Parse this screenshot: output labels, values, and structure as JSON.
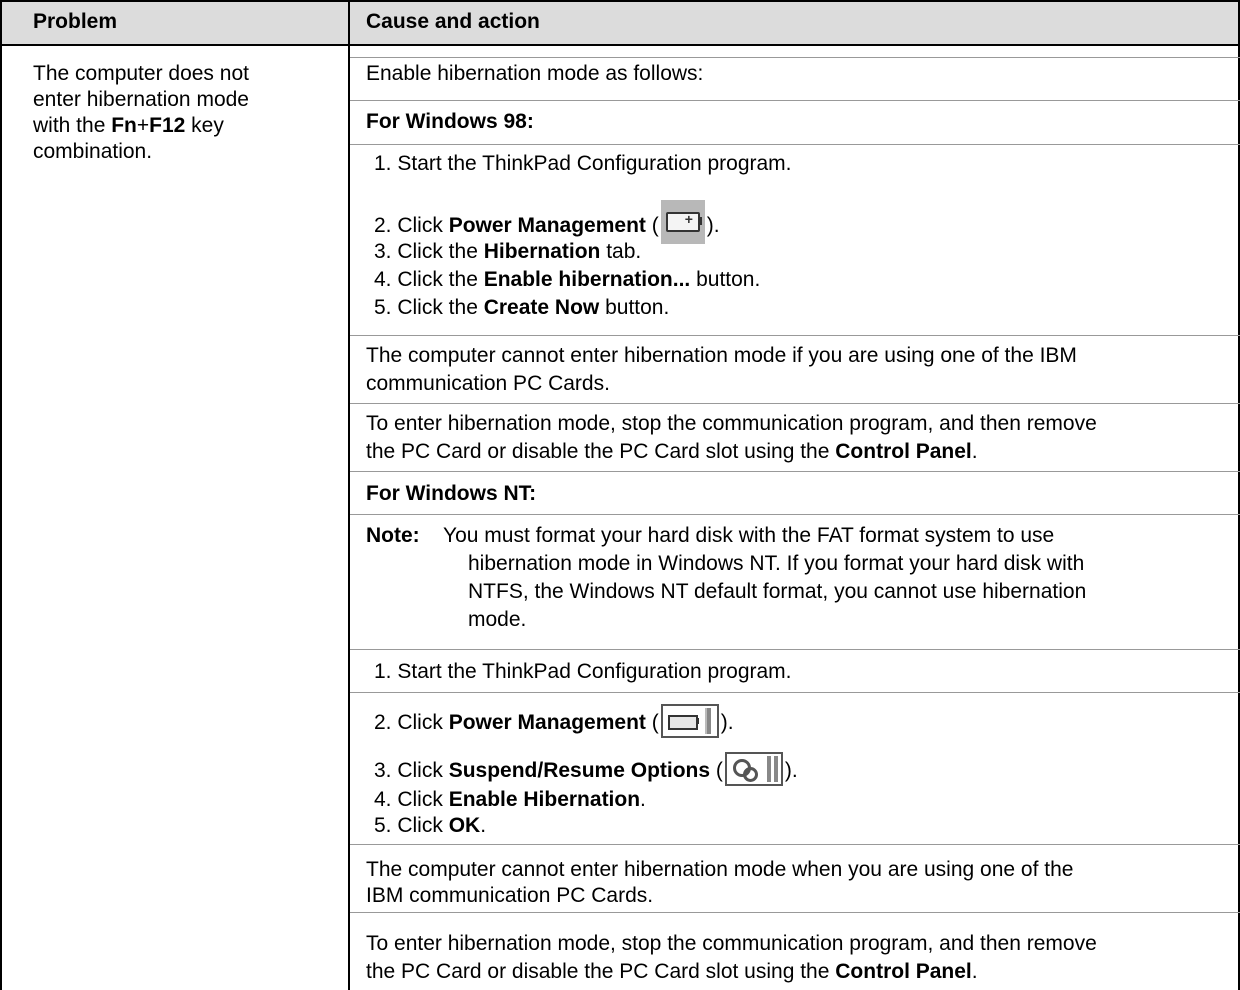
{
  "header": {
    "problem_col": "Problem",
    "cause_col": "Cause and action"
  },
  "problem": {
    "line1": "The computer does not",
    "line2": "enter hibernation mode",
    "line3_pre": "with the ",
    "line3_fn": "Fn",
    "line3_plus": "+",
    "line3_f12": "F12",
    "line3_post": " key",
    "line4": "combination."
  },
  "cause": {
    "intro": "Enable hibernation mode as follows:",
    "win98_heading": "For Windows 98:",
    "w98_s1": "1. Start the ThinkPad Configuration program.",
    "w98_s2_pre": "2. Click ",
    "w98_s2_b": "Power Management",
    "w98_s2_open": " (",
    "w98_s2_close": ").",
    "w98_s3_pre": "3. Click the ",
    "w98_s3_b": "Hibernation",
    "w98_s3_post": " tab.",
    "w98_s4_pre": "4. Click the ",
    "w98_s4_b": "Enable hibernation...",
    "w98_s4_post": " button.",
    "w98_s5_pre": "5. Click the ",
    "w98_s5_b": "Create Now",
    "w98_s5_post": " button.",
    "w98_p1_l1": "The computer cannot enter hibernation mode if you are using one of the IBM",
    "w98_p1_l2": "communication PC Cards.",
    "w98_p2_l1": "To enter hibernation mode, stop the communication program, and then remove",
    "w98_p2_l2_pre": "the PC Card or disable the PC Card slot using the ",
    "w98_p2_l2_b": "Control Panel",
    "w98_p2_l2_post": ".",
    "nt_heading": "For Windows NT:",
    "note_label": "Note:",
    "note_l1": "You must format your hard disk with the FAT format system to use",
    "note_l2": "hibernation mode in Windows NT.  If you format your hard disk with",
    "note_l3": "NTFS, the Windows NT default format, you cannot use hibernation",
    "note_l4": "mode.",
    "nt_s1": "1. Start the ThinkPad Configuration program.",
    "nt_s2_pre": "2. Click ",
    "nt_s2_b": "Power Management",
    "nt_s2_open": " (",
    "nt_s2_close": ").",
    "nt_s3_pre": "3. Click ",
    "nt_s3_b": "Suspend/Resume Options",
    "nt_s3_open": " (",
    "nt_s3_close": ").",
    "nt_s4_pre": "4. Click ",
    "nt_s4_b": "Enable Hibernation",
    "nt_s4_post": ".",
    "nt_s5_pre": "5. Click ",
    "nt_s5_b": "OK",
    "nt_s5_post": ".",
    "nt_p1_l1": "The computer cannot enter hibernation mode when you are using one of the",
    "nt_p1_l2": "IBM communication PC Cards.",
    "nt_p2_l1": "To enter hibernation mode, stop the communication program, and then remove",
    "nt_p2_l2_pre": "the PC Card or disable the PC Card slot using the ",
    "nt_p2_l2_b": "Control Panel",
    "nt_p2_l2_post": "."
  },
  "icons": {
    "win98_power": "battery-icon",
    "nt_power": "battery-icon",
    "nt_suspend": "gears-icon"
  }
}
